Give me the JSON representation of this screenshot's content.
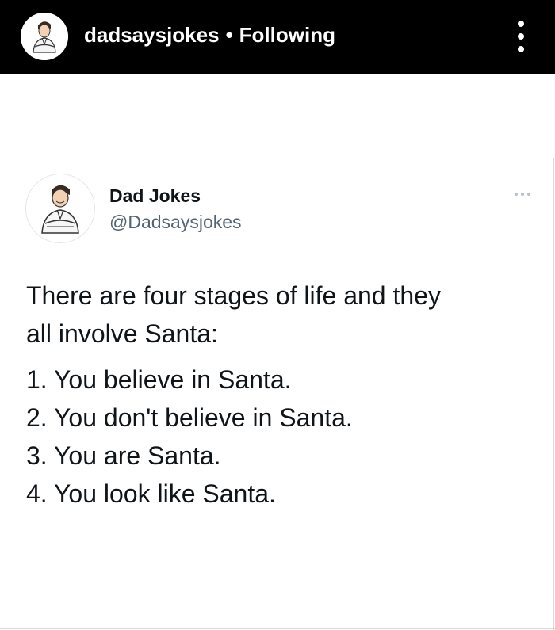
{
  "header": {
    "username": "dadsaysjokes",
    "separator": "•",
    "follow_status": "Following",
    "avatar_icon": "dad-cartoon-avatar-icon",
    "menu_icon": "vertical-ellipsis-icon"
  },
  "tweet": {
    "display_name": "Dad Jokes",
    "handle": "@Dadsaysjokes",
    "avatar_icon": "dad-cartoon-avatar-icon",
    "more_icon": "horizontal-ellipsis-icon",
    "intro_line1": "There are four stages of life and they",
    "intro_line2": "all involve Santa:",
    "stages": [
      "1. You believe in Santa.",
      "2. You don't believe in Santa.",
      "3. You are Santa.",
      "4. You look like Santa."
    ]
  },
  "colors": {
    "header_bg": "#000000",
    "header_text": "#ffffff",
    "name_text": "#0f1419",
    "handle_text": "#536471"
  }
}
